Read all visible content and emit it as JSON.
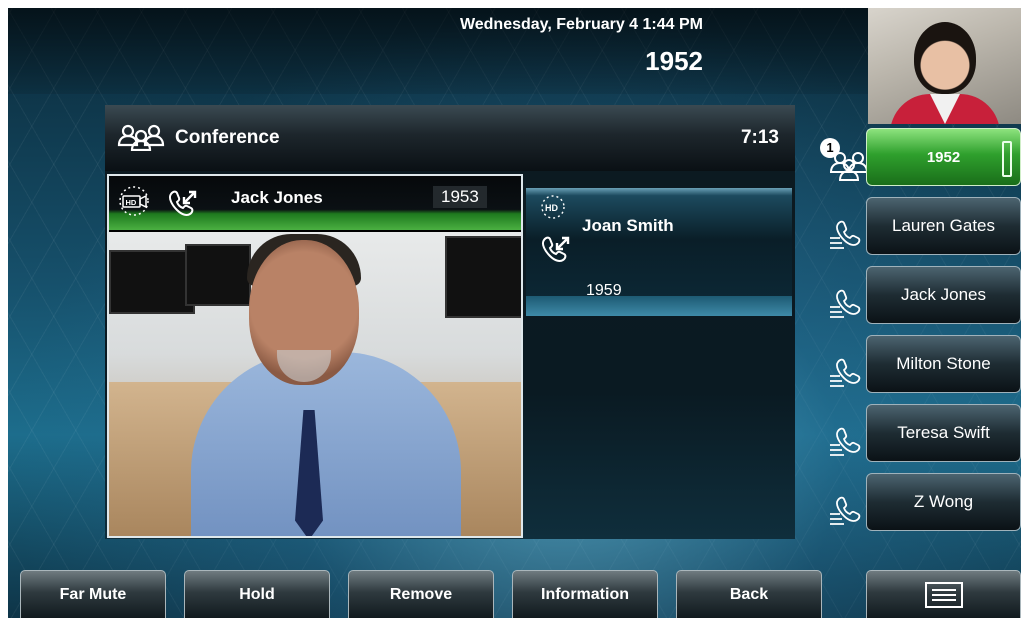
{
  "header": {
    "datetime": "Wednesday, February 4  1:44 PM",
    "extension": "1952"
  },
  "conference": {
    "title": "Conference",
    "duration": "7:13"
  },
  "calls": [
    {
      "name": "Jack Jones",
      "number": "1953",
      "hd_label": "HD"
    },
    {
      "name": "Joan Smith",
      "number": "1959",
      "hd_label": "HD"
    }
  ],
  "lines": {
    "active": {
      "label": "1952",
      "badge": "1"
    },
    "contacts": [
      "Lauren Gates",
      "Jack Jones",
      "Milton Stone",
      "Teresa Swift",
      "Z Wong"
    ]
  },
  "softkeys": [
    "Far Mute",
    "Hold",
    "Remove",
    "Information",
    "Back"
  ],
  "colors": {
    "active_line": "#2fa02d",
    "accent": "#1d6d8c"
  }
}
